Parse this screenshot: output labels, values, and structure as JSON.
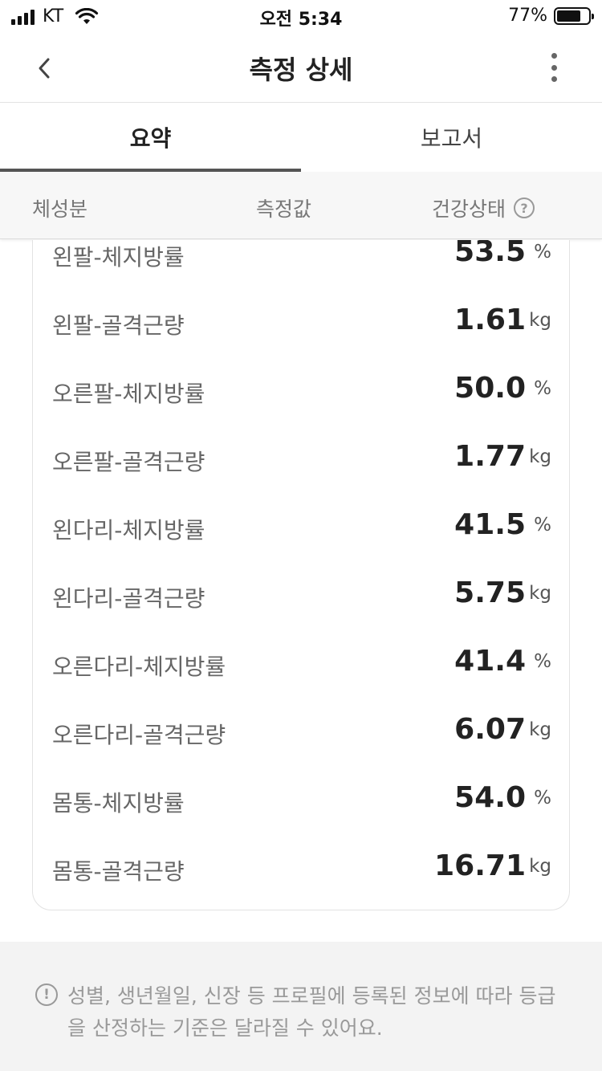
{
  "status_bar": {
    "carrier": "KT",
    "time": "오전 5:34",
    "battery": "77%"
  },
  "nav": {
    "title": "측정 상세"
  },
  "tabs": [
    {
      "label": "요약",
      "active": true
    },
    {
      "label": "보고서",
      "active": false
    }
  ],
  "columns": {
    "body": "체성분",
    "value": "측정값",
    "health": "건강상태",
    "help_icon": "?"
  },
  "rows": [
    {
      "label": "왼팔-체지방률",
      "value": "53.5",
      "unit": "%"
    },
    {
      "label": "왼팔-골격근량",
      "value": "1.61",
      "unit": "kg"
    },
    {
      "label": "오른팔-체지방률",
      "value": "50.0",
      "unit": "%"
    },
    {
      "label": "오른팔-골격근량",
      "value": "1.77",
      "unit": "kg"
    },
    {
      "label": "왼다리-체지방률",
      "value": "41.5",
      "unit": "%"
    },
    {
      "label": "왼다리-골격근량",
      "value": "5.75",
      "unit": "kg"
    },
    {
      "label": "오른다리-체지방률",
      "value": "41.4",
      "unit": "%"
    },
    {
      "label": "오른다리-골격근량",
      "value": "6.07",
      "unit": "kg"
    },
    {
      "label": "몸통-체지방률",
      "value": "54.0",
      "unit": "%"
    },
    {
      "label": "몸통-골격근량",
      "value": "16.71",
      "unit": "kg"
    }
  ],
  "notice": {
    "icon": "!",
    "text": "성별, 생년월일, 신장 등 프로필에 등록된 정보에 따라 등급을 산정하는 기준은 달라질 수 있어요."
  }
}
